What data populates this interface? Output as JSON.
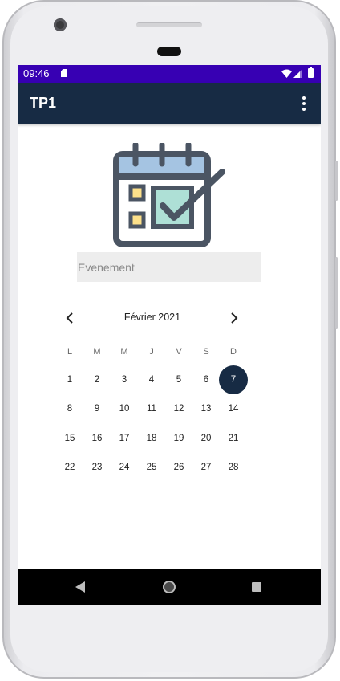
{
  "status_bar": {
    "time": "09:46"
  },
  "app_bar": {
    "title": "TP1"
  },
  "event_input": {
    "placeholder": "Evenement",
    "value": ""
  },
  "calendar": {
    "month_label": "Février 2021",
    "weekdays": [
      "L",
      "M",
      "M",
      "J",
      "V",
      "S",
      "D"
    ],
    "weeks": [
      [
        "1",
        "2",
        "3",
        "4",
        "5",
        "6",
        "7"
      ],
      [
        "8",
        "9",
        "10",
        "11",
        "12",
        "13",
        "14"
      ],
      [
        "15",
        "16",
        "17",
        "18",
        "19",
        "20",
        "21"
      ],
      [
        "22",
        "23",
        "24",
        "25",
        "26",
        "27",
        "28"
      ]
    ],
    "selected_day": "7",
    "selected_color": "#172b44"
  },
  "colors": {
    "status_bar": "#3700b3",
    "app_bar": "#172b44"
  },
  "icons": {
    "illustration": "calendar-check-icon",
    "prev": "chevron-left-icon",
    "next": "chevron-right-icon",
    "overflow": "more-vert-icon"
  }
}
